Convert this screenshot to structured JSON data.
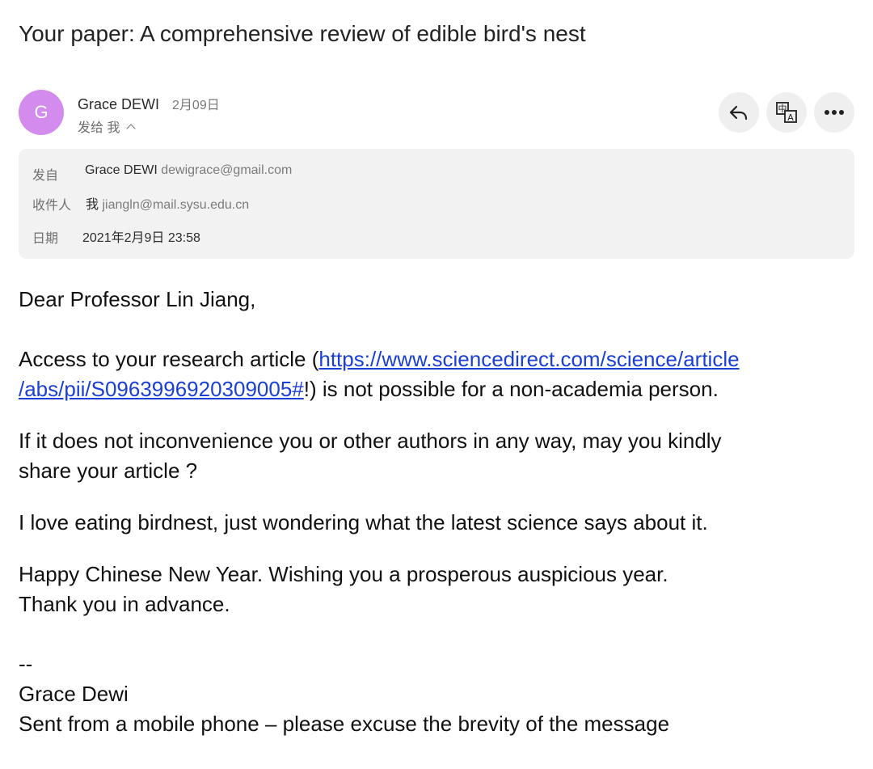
{
  "subject": "Your paper: A comprehensive review of edible bird's nest",
  "sender": {
    "avatar_letter": "G",
    "avatar_color": "#d48bee",
    "name": "Grace DEWI",
    "date": "2月09日",
    "to_summary": "发给 我"
  },
  "actions": {
    "reply_icon": "reply-icon",
    "translate_icon": "translate-icon",
    "more_icon": "more-icon"
  },
  "details": {
    "from_label": "发自",
    "from_name": "Grace DEWI",
    "from_email": "dewigrace@gmail.com",
    "to_label": "收件人",
    "to_name": "我",
    "to_email": "jiangln@mail.sysu.edu.cn",
    "date_label": "日期",
    "date_value": "2021年2月9日 23:58"
  },
  "body": {
    "greeting": "Dear Professor Lin Jiang,",
    "access_prefix": "Access to your research article (",
    "link_line1": "https://www.sciencedirect.com/science/article",
    "link_line2": "/abs/pii/S0963996920309005#",
    "access_suffix": "!) is not possible for a non-academia person.",
    "request_line1": "If it does not inconvenience you or other authors in any way, may you kindly",
    "request_line2": "share your article ?",
    "love_line": "I love eating birdnest, just wondering what the latest science says about it.",
    "newyear_line": "Happy Chinese New Year. Wishing you a prosperous auspicious year.",
    "thanks_line": "Thank you in advance.",
    "sig_separator": "--",
    "sig_name": "Grace Dewi",
    "sig_note": "Sent from a mobile phone – please excuse the brevity of the message"
  },
  "colors": {
    "link": "#1a3fd6",
    "details_bg": "#f2f2f2",
    "button_bg": "#efefef"
  }
}
